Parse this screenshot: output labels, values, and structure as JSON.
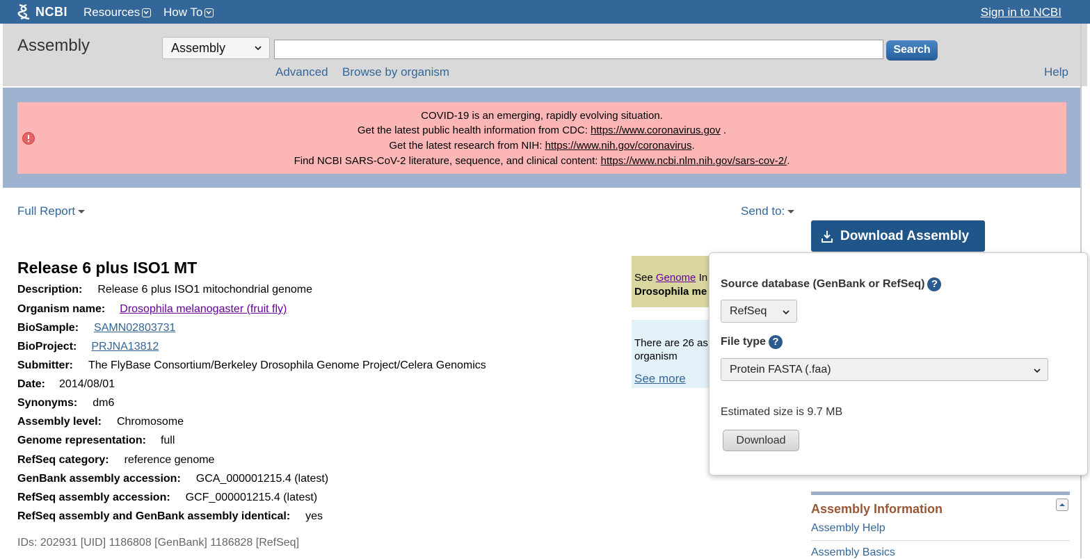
{
  "header": {
    "logo": "NCBI",
    "menu": [
      "Resources",
      "How To"
    ],
    "signin": "Sign in to NCBI"
  },
  "search": {
    "title": "Assembly",
    "database": "Assembly",
    "button": "Search",
    "links": [
      "Advanced",
      "Browse by organism"
    ],
    "help": "Help"
  },
  "alert": {
    "line1": "COVID-19 is an emerging, rapidly evolving situation.",
    "line2_text": "Get the latest public health information from CDC: ",
    "line2_link": "https://www.coronavirus.gov",
    "line2_end": " .",
    "line3_text": "Get the latest research from NIH: ",
    "line3_link": "https://www.nih.gov/coronavirus",
    "line3_end": ".",
    "line4_text": "Find NCBI SARS-CoV-2 literature, sequence, and clinical content: ",
    "line4_link": "https://www.ncbi.nlm.nih.gov/sars-cov-2/",
    "line4_end": "."
  },
  "controls": {
    "full_report": "Full Report",
    "send_to": "Send to:",
    "download_assembly": "Download Assembly"
  },
  "record": {
    "title": "Release 6 plus ISO1 MT",
    "fields": [
      {
        "label": "Description:",
        "value": "Release 6 plus ISO1 mitochondrial genome"
      },
      {
        "label": "Organism name:",
        "value": "Drosophila melanogaster (fruit fly)"
      },
      {
        "label": "BioSample:",
        "value": "SAMN02803731"
      },
      {
        "label": "BioProject:",
        "value": "PRJNA13812"
      },
      {
        "label": "Submitter:",
        "value": "The FlyBase Consortium/Berkeley Drosophila Genome Project/Celera Genomics"
      },
      {
        "label": "Date:",
        "value": "2014/08/01"
      },
      {
        "label": "Synonyms:",
        "value": "dm6"
      },
      {
        "label": "Assembly level:",
        "value": "Chromosome"
      },
      {
        "label": "Genome representation:",
        "value": "full"
      },
      {
        "label": "RefSeq category:",
        "value": "reference genome"
      },
      {
        "label": "GenBank assembly accession:",
        "value": "GCA_000001215.4 (latest)"
      },
      {
        "label": "RefSeq assembly accession:",
        "value": "GCF_000001215.4 (latest)"
      },
      {
        "label": "RefSeq assembly and GenBank assembly identical:",
        "value": "yes"
      }
    ],
    "ids": "IDs: 202931 [UID] 1186808 [GenBank] 1186828 [RefSeq]"
  },
  "side": {
    "genome_prefix": "See ",
    "genome_link": "Genome",
    "genome_suffix": " In",
    "genome_org": "Drosophila me",
    "assemblies_line1": "There are 26 as",
    "assemblies_line2": "organism",
    "see_more": "See more"
  },
  "popup": {
    "source_label": "Source database (GenBank or RefSeq)",
    "source_value": "RefSeq",
    "filetype_label": "File type",
    "filetype_value": "Protein FASTA (.faa)",
    "help_glyph": "?",
    "estimated": "Estimated size is 9.7 MB",
    "download": "Download"
  },
  "info": {
    "title": "Assembly Information",
    "links": [
      "Assembly Help",
      "Assembly Basics"
    ]
  },
  "colors": {
    "topbar": "#336699",
    "alert_bg": "#fdb6b6",
    "download_button": "#20558a",
    "info_title": "#985735"
  }
}
